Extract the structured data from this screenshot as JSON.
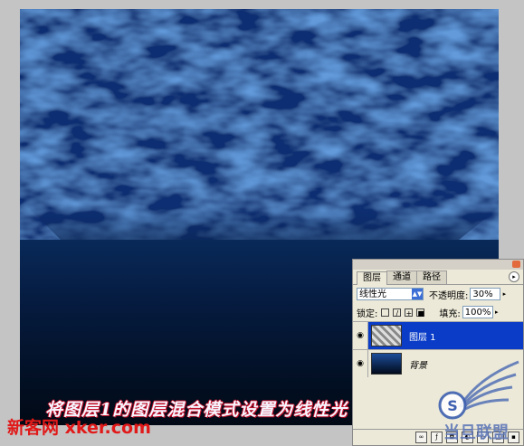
{
  "canvas": {
    "description": ""
  },
  "layers_panel": {
    "tabs": [
      "图层",
      "通道",
      "路径"
    ],
    "blend_mode": "线性光",
    "opacity_label": "不透明度:",
    "opacity_value": "30%",
    "lock_label": "锁定:",
    "fill_label": "填充:",
    "fill_value": "100%",
    "layers": [
      {
        "name": "图层 1",
        "selected": true
      },
      {
        "name": "背景",
        "selected": false
      }
    ]
  },
  "caption": "将图层1的图层混合模式设置为线性光",
  "watermark_left": "新客网 xker.com",
  "watermark_right": "当旦联盟"
}
